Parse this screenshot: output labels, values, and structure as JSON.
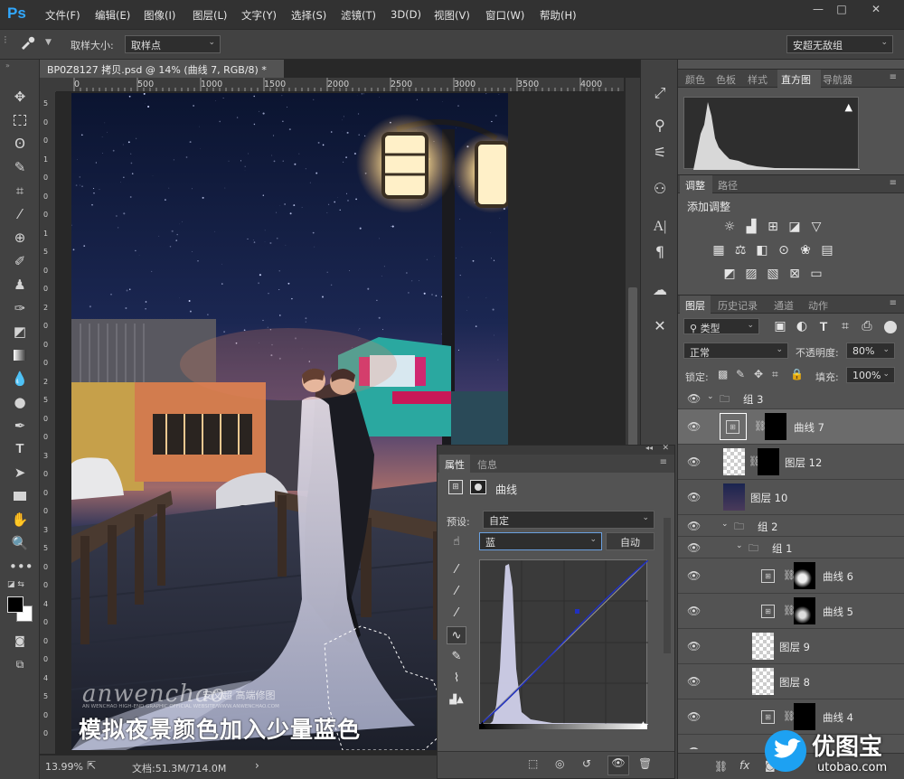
{
  "app": {
    "logo": "Ps"
  },
  "menu": [
    "文件(F)",
    "编辑(E)",
    "图像(I)",
    "图层(L)",
    "文字(Y)",
    "选择(S)",
    "滤镜(T)",
    "3D(D)",
    "视图(V)",
    "窗口(W)",
    "帮助(H)"
  ],
  "window_controls": [
    "—",
    "□",
    "✕"
  ],
  "options": {
    "sample_size_label": "取样大小:",
    "sample_size_value": "取样点",
    "workspace": "安超无敌组"
  },
  "document": {
    "tab_title": "BP0Z8127 拷贝.psd @ 14% (曲线 7, RGB/8) *",
    "ruler_h": [
      "0",
      "500",
      "1000",
      "1500",
      "2000",
      "2500",
      "3000",
      "3500",
      "4000"
    ],
    "ruler_v": [
      "5",
      "0",
      "0",
      "1",
      "0",
      "0",
      "0",
      "1",
      "5",
      "0",
      "0",
      "2",
      "0",
      "0",
      "0",
      "2",
      "5",
      "0",
      "0",
      "3",
      "0",
      "0",
      "0",
      "3",
      "5",
      "0",
      "0",
      "4",
      "0",
      "0",
      "0",
      "4",
      "5",
      "0",
      "0"
    ],
    "caption": "模拟夜景颜色加入少量蓝色",
    "watermark_main": "anwenchao",
    "watermark_cn": "安文超 高端修图",
    "watermark_sub": "AN WENCHAO HIGH-END GRAPHIC OFFICIAL WEBSITE/WWW.ANWENCHAO.COM",
    "zoom": "13.99%",
    "doc_size": "文档:51.3M/714.0M"
  },
  "histogram_panel": {
    "tabs": [
      "颜色",
      "色板",
      "样式",
      "直方图",
      "导航器"
    ],
    "active": "直方图",
    "warning": "▲"
  },
  "adjustments_panel": {
    "tabs": [
      "调整",
      "路径"
    ],
    "title": "添加调整"
  },
  "layers_panel": {
    "tabs": [
      "图层",
      "历史记录",
      "通道",
      "动作"
    ],
    "filter_kind": "类型",
    "blend_mode": "正常",
    "opacity_label": "不透明度:",
    "opacity_value": "80%",
    "lock_label": "锁定:",
    "fill_label": "填充:",
    "fill_value": "100%",
    "layers": [
      {
        "name": "组 3",
        "type": "group"
      },
      {
        "name": "曲线 7",
        "type": "curves"
      },
      {
        "name": "图层 12",
        "type": "pixel"
      },
      {
        "name": "图层 10",
        "type": "pixel"
      },
      {
        "name": "组 2",
        "type": "group"
      },
      {
        "name": "组 1",
        "type": "group"
      },
      {
        "name": "曲线 6",
        "type": "curves"
      },
      {
        "name": "曲线 5",
        "type": "curves"
      },
      {
        "name": "图层 9",
        "type": "pixel"
      },
      {
        "name": "图层 8",
        "type": "pixel"
      },
      {
        "name": "曲线 4",
        "type": "curves"
      }
    ]
  },
  "properties_panel": {
    "tabs": [
      "属性",
      "信息"
    ],
    "title": "曲线",
    "preset_label": "预设:",
    "preset_value": "自定",
    "channel_value": "蓝",
    "auto_button": "自动"
  },
  "logo_watermark": {
    "cn": "优图宝",
    "url": "utobao.com"
  }
}
